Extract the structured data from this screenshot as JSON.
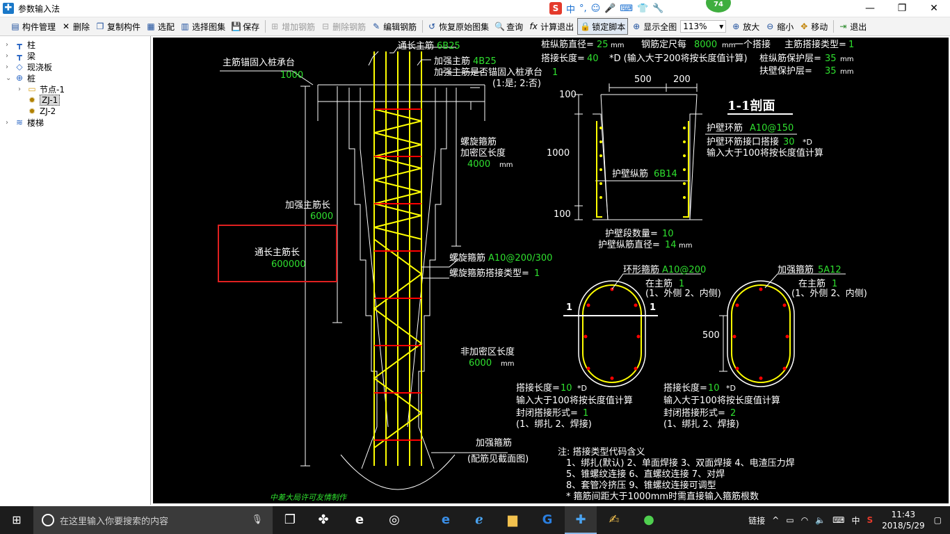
{
  "window": {
    "title": "参数输入法",
    "badge": "74"
  },
  "ime": {
    "items": [
      "中",
      "°,",
      "☺",
      "🎤",
      "⌨",
      "👕",
      "🔧"
    ]
  },
  "toolbar": {
    "items": [
      {
        "label": "构件管理",
        "icon": "▤",
        "state": "normal"
      },
      {
        "label": "删除",
        "icon": "✕",
        "state": "normal"
      },
      {
        "label": "复制构件",
        "icon": "❐",
        "state": "normal"
      },
      {
        "label": "选配",
        "icon": "▦",
        "state": "normal"
      },
      {
        "label": "选择图集",
        "icon": "▥",
        "state": "normal"
      },
      {
        "label": "保存",
        "icon": "💾",
        "state": "normal"
      },
      {
        "label": "增加钢筋",
        "icon": "⊞",
        "state": "disabled"
      },
      {
        "label": "删除钢筋",
        "icon": "⊟",
        "state": "disabled"
      },
      {
        "label": "编辑钢筋",
        "icon": "✎",
        "state": "normal"
      },
      {
        "label": "恢复原始图集",
        "icon": "↺",
        "state": "normal"
      },
      {
        "label": "查询",
        "icon": "🔍",
        "state": "normal"
      },
      {
        "label": "计算退出",
        "icon": "fx",
        "state": "normal"
      },
      {
        "label": "锁定脚本",
        "icon": "🔒",
        "state": "active"
      },
      {
        "label": "显示全图",
        "icon": "⊕",
        "state": "normal"
      }
    ],
    "zoom": "113%",
    "items2": [
      {
        "label": "放大",
        "icon": "⊕"
      },
      {
        "label": "缩小",
        "icon": "⊖"
      },
      {
        "label": "移动",
        "icon": "✥"
      },
      {
        "label": "退出",
        "icon": "⇥"
      }
    ]
  },
  "tree": {
    "nodes": [
      {
        "label": "柱",
        "icon": "┳",
        "expander": "›"
      },
      {
        "label": "梁",
        "icon": "┳",
        "expander": "›"
      },
      {
        "label": "现浇板",
        "icon": "◇",
        "expander": "›"
      },
      {
        "label": "桩",
        "icon": "⊕",
        "expander": "⌄"
      },
      {
        "label": "节点-1",
        "icon": "▭",
        "expander": "›"
      },
      {
        "label": "ZJ-1",
        "icon": "✹",
        "expander": ""
      },
      {
        "label": "ZJ-2",
        "icon": "✹",
        "expander": ""
      },
      {
        "label": "楼梯",
        "icon": "≋",
        "expander": "›"
      }
    ]
  },
  "drawing": {
    "anchor_label": "主筋锚固入桩承台",
    "anchor_value": "1000",
    "main_rebar_label": "通长主筋",
    "main_rebar_value": "6B25",
    "reinf_rebar_label": "加强主筋",
    "reinf_rebar_value": "4B25",
    "anchor_flag_label": "加强主筋是否锚固入桩承台",
    "anchor_flag_value": "1",
    "anchor_flag_note": "(1:是; 2:否)",
    "spiral_dense_1": "螺旋箍筋",
    "spiral_dense_2": "加密区长度",
    "spiral_dense_value": "4000",
    "mm": "mm",
    "reinf_len_label": "加强主筋长",
    "reinf_len_value": "6000",
    "full_len_label": "通长主筋长",
    "full_len_value": "600000",
    "spiral_label": "螺旋箍筋",
    "spiral_value": "A10@200/300",
    "spiral_lap_label": "螺旋箍筋搭接类型=",
    "spiral_lap_value": "1",
    "nondense_label": "非加密区长度",
    "nondense_value": "6000",
    "reinf_hoop_label": "加强箍筋",
    "reinf_hoop_note": "(配筋见截面图)",
    "watermark": "中差大局许可友情制作",
    "pile_dia_label": "桩纵筋直径=",
    "pile_dia_value": "25",
    "fixed_len_label": "钢筋定尺每",
    "fixed_len_value": "8000",
    "fixed_len_tail": "一个搭接",
    "lap_type_label": "主筋搭接类型=",
    "lap_type_value": "1",
    "lap_len_label": "搭接长度=",
    "lap_len_value": "40",
    "lap_len_note": "*D (输入大于200将按长度值计算)",
    "cover_label": "桩纵筋保护层=",
    "cover_value": "35",
    "wall_cover_label": "扶壁保护层=",
    "wall_cover_value": "35",
    "dim_500": "500",
    "dim_200": "200",
    "dim_100a": "100",
    "dim_1000": "1000",
    "dim_100b": "100",
    "section_title": "1-1剖面",
    "ring_label": "护壁环筋",
    "ring_value": "A10@150",
    "ring_lap_label": "护壁环筋接口搭接",
    "ring_lap_value": "30",
    "ring_lap_d": "*D",
    "ring_lap_note": "输入大于100将按长度值计算",
    "wall_long_label": "护壁纵筋",
    "wall_long_value": "6B14",
    "seg_count_label": "护壁段数量=",
    "seg_count_value": "10",
    "wall_dia_label": "护壁纵筋直径=",
    "wall_dia_value": "14",
    "ring_hoop_label": "环形箍筋",
    "ring_hoop_value": "A10@200",
    "in_main_label": "在主筋",
    "in_main_value": "1",
    "in_main_note": "(1、外侧  2、内侧)",
    "sec_mark": "1",
    "lap1_label": "搭接长度=",
    "lap1_value": "10",
    "lap_d": "*D",
    "lap_note": "输入大于100将按长度值计算",
    "close_label": "封闭搭接形式=",
    "close1_value": "1",
    "close_note": "(1、绑扎  2、焊接)",
    "reinf_hoop2_label": "加强箍筋",
    "reinf_hoop2_value": "5A12",
    "in_main2_value": "1",
    "dim_500b": "500",
    "lap2_value": "10",
    "close2_value": "2",
    "notes": [
      "注: 搭接类型代码含义",
      "1、绑扎(默认)   2、单面焊接   3、双面焊接   4、电渣压力焊",
      "5、锥螺纹连接   6、直螺纹连接   7、对焊",
      "8、套管冷挤压   9、锥螺纹连接可调型",
      "* 箍筋间距大于1000mm时需直接输入箍筋根数"
    ]
  },
  "taskbar": {
    "search_placeholder": "在这里输入你要搜索的内容",
    "tray_link": "链接",
    "tray_ime": "中",
    "time": "11:43",
    "date": "2018/5/29"
  },
  "colors": {
    "canvas_bg": "#000000",
    "value_green": "#2fe02f",
    "rebar_yellow": "#ffff00",
    "tie_red": "#ff0000",
    "highlight_red": "#e02020"
  }
}
